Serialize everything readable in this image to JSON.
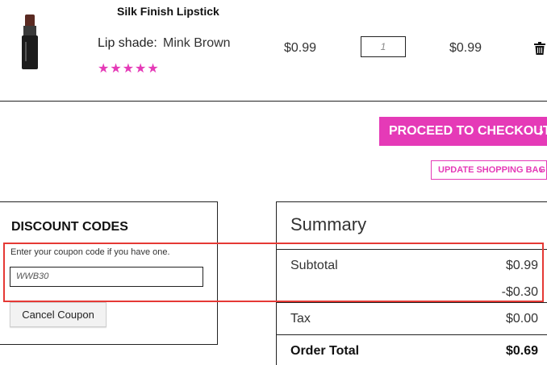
{
  "product": {
    "title": "Silk Finish Lipstick",
    "shade_label": "Lip shade:",
    "shade_value": "Mink Brown",
    "rating_stars": "★★★★★",
    "rating_value": 4.5,
    "price": "$0.99",
    "quantity": "1",
    "line_total": "$0.99",
    "delete_icon": "trash-icon"
  },
  "actions": {
    "checkout_label": "PROCEED TO CHECKOUT",
    "update_label": "UPDATE SHOPPING BAG",
    "chevron": "›"
  },
  "discount": {
    "title": "DISCOUNT CODES",
    "hint": "Enter your coupon code if you have one.",
    "coupon_value": "WWB30",
    "cancel_label": "Cancel Coupon"
  },
  "summary": {
    "title": "Summary",
    "subtotal_label": "Subtotal",
    "subtotal_value": "$0.99",
    "discount_value": "-$0.30",
    "tax_label": "Tax",
    "tax_value": "$0.00",
    "order_total_label": "Order Total",
    "order_total_value": "$0.69"
  },
  "colors": {
    "accent": "#e53ab7",
    "highlight": "#e53935"
  }
}
